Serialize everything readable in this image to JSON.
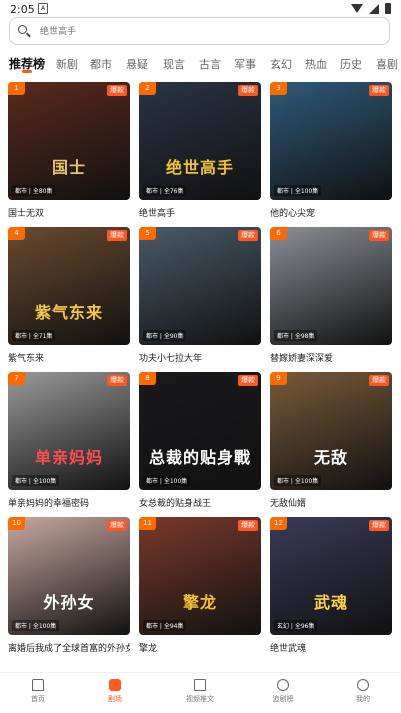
{
  "status_bar": {
    "time": "2:05"
  },
  "search": {
    "placeholder": "绝世高手"
  },
  "tabs": [
    "推荐榜",
    "新剧",
    "都市",
    "悬疑",
    "现言",
    "古言",
    "军事",
    "玄幻",
    "热血",
    "历史",
    "喜剧"
  ],
  "hot_label": "爆款",
  "cards": [
    {
      "rank": "1",
      "title": "国士无双",
      "meta": "都市 | 全80集",
      "poster": "国士",
      "bg": "#5a2a1e",
      "accent": "#e8c46a"
    },
    {
      "rank": "2",
      "title": "绝世高手",
      "meta": "都市 | 全76集",
      "poster": "绝世高手",
      "bg": "#2a3446",
      "accent": "#f2c230"
    },
    {
      "rank": "3",
      "title": "他的心尖宠",
      "meta": "都市 | 全100集",
      "poster": "",
      "bg": "#2f5a7a",
      "accent": "#ffffff"
    },
    {
      "rank": "4",
      "title": "紫气东来",
      "meta": "都市 | 全71集",
      "poster": "紫气东来",
      "bg": "#6a4a2e",
      "accent": "#f4c64c"
    },
    {
      "rank": "5",
      "title": "功夫小七拉大年",
      "meta": "都市 | 全90集",
      "poster": "",
      "bg": "#4a5a68",
      "accent": "#ffffff"
    },
    {
      "rank": "6",
      "title": "替嫁娇妻深深爱",
      "meta": "都市 | 全98集",
      "poster": "",
      "bg": "#8a8f96",
      "accent": "#ffffff"
    },
    {
      "rank": "7",
      "title": "单亲妈妈的幸福密码",
      "meta": "都市 | 全100集",
      "poster": "单亲妈妈",
      "bg": "#9a9a9a",
      "accent": "#ff4d4d"
    },
    {
      "rank": "8",
      "title": "女总裁的贴身战王",
      "meta": "都市 | 全100集",
      "poster": "总裁的贴身戰",
      "bg": "#1a1a1e",
      "accent": "#ffffff"
    },
    {
      "rank": "9",
      "title": "无敌仙婿",
      "meta": "都市 | 全100集",
      "poster": "无敌",
      "bg": "#7a5a3a",
      "accent": "#ffffff"
    },
    {
      "rank": "10",
      "title": "离婚后我成了全球首富的外孙女",
      "meta": "都市 | 全100集",
      "poster": "外孙女",
      "bg": "#c9a7a0",
      "accent": "#ffffff"
    },
    {
      "rank": "11",
      "title": "擎龙",
      "meta": "都市 | 全94集",
      "poster": "擎龙",
      "bg": "#7a3a2a",
      "accent": "#f2c230"
    },
    {
      "rank": "12",
      "title": "绝世武魂",
      "meta": "玄幻 | 全96集",
      "poster": "武魂",
      "bg": "#3a3a5a",
      "accent": "#ffd24a"
    }
  ],
  "bottom_nav": [
    {
      "label": "首页",
      "icon": "home-icon"
    },
    {
      "label": "剧场",
      "icon": "theater-icon"
    },
    {
      "label": "视频推文",
      "icon": "book-icon"
    },
    {
      "label": "追剧榜",
      "icon": "clock-icon"
    },
    {
      "label": "我的",
      "icon": "settings-icon"
    }
  ],
  "colors": {
    "accent": "#ff5a1f",
    "hot": "#ff5722",
    "rank": "#ff6a00"
  }
}
